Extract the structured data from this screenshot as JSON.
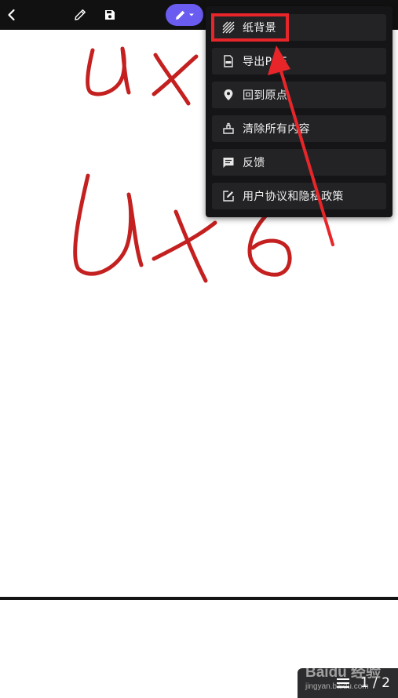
{
  "toolbar": {
    "back_icon": "chevron-left-icon",
    "pencil_icon": "pencil-icon",
    "save_icon": "save-icon",
    "pen_tool_icon": "pen-icon",
    "pen_tool_dropdown_icon": "caret-down-icon",
    "accent_color": "#6a5cf0"
  },
  "menu": {
    "items": [
      {
        "label": "纸背景",
        "icon": "paper-texture-icon"
      },
      {
        "label": "导出PDF",
        "icon": "pdf-file-icon"
      },
      {
        "label": "回到原点",
        "icon": "location-pin-icon"
      },
      {
        "label": "清除所有内容",
        "icon": "eraser-icon"
      },
      {
        "label": "反馈",
        "icon": "feedback-icon"
      },
      {
        "label": "用户协议和隐私政策",
        "icon": "edit-document-icon"
      }
    ]
  },
  "annotation": {
    "highlight_color": "#e8262a"
  },
  "canvas": {
    "ink_color": "#c42020"
  },
  "page_indicator": {
    "pages": "1 / 2",
    "icon": "list-icon"
  },
  "watermark": {
    "brand": "Baidu 经验",
    "site": "jingyan.baidu.com"
  }
}
